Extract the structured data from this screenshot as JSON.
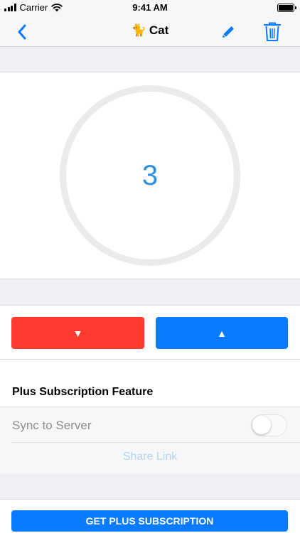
{
  "status_bar": {
    "carrier": "Carrier",
    "time": "9:41 AM",
    "battery_level": 1.0
  },
  "nav": {
    "title_emoji": "🐈",
    "title": "Cat",
    "icons": {
      "back": "chevron-left-icon",
      "edit": "pencil-icon",
      "delete": "trash-icon"
    },
    "accent_color": "#0a7bff"
  },
  "counter": {
    "value": "3",
    "value_color": "#2d8fe0"
  },
  "controls": {
    "decrement_label": "▼",
    "increment_label": "▲",
    "decrement_color": "#ff3b30",
    "increment_color": "#0a7bff"
  },
  "plus_section": {
    "title": "Plus Subscription Feature",
    "sync_label": "Sync to Server",
    "sync_enabled": false,
    "share_link_label": "Share Link"
  },
  "subscribe": {
    "label": "GET PLUS SUBSCRIPTION"
  }
}
